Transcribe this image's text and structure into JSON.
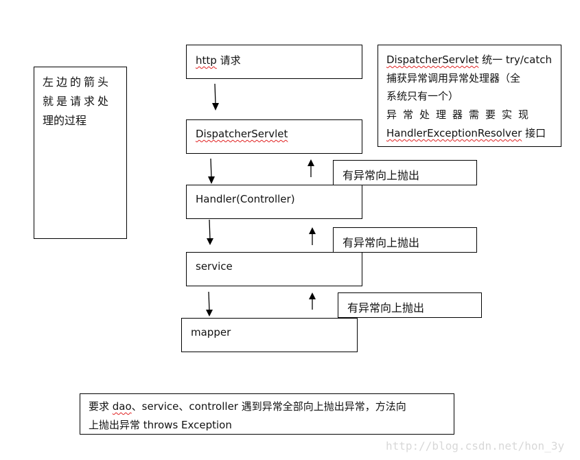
{
  "left_note": {
    "lines": [
      "左边的箭头",
      "就是请求处",
      "理的过程"
    ]
  },
  "flow": {
    "http_request": {
      "prefix": "http",
      "suffix": " 请求"
    },
    "dispatcher": "DispatcherServlet",
    "handler": "Handler(Controller)",
    "service": "service",
    "mapper": "mapper"
  },
  "throw_labels": [
    "有异常向上抛出",
    "有异常向上抛出",
    "有异常向上抛出"
  ],
  "right_note": {
    "line1_term": "DispatcherServlet",
    "line1_rest": " 统一 try/catch",
    "line2": "捕获异常调用异常处理器（全",
    "line3": "系统只有一个）",
    "line4": "异常处理器需要实现",
    "line5_term": "HandlerExceptionResolver",
    "line5_rest": " 接口"
  },
  "bottom_note": {
    "line1_a": "要求 ",
    "line1_term": "dao",
    "line1_b": "、service、controller 遇到异常全部向上抛出异常，方法向",
    "line2": "上抛出异常 throws Exception"
  },
  "watermark": "http://blog.csdn.net/hon_3y",
  "arrows": {
    "down": [
      "http-to-dispatcher",
      "dispatcher-to-handler",
      "handler-to-service",
      "service-to-mapper"
    ],
    "up": [
      "handler-to-dispatcher",
      "service-to-handler",
      "mapper-to-service"
    ]
  }
}
